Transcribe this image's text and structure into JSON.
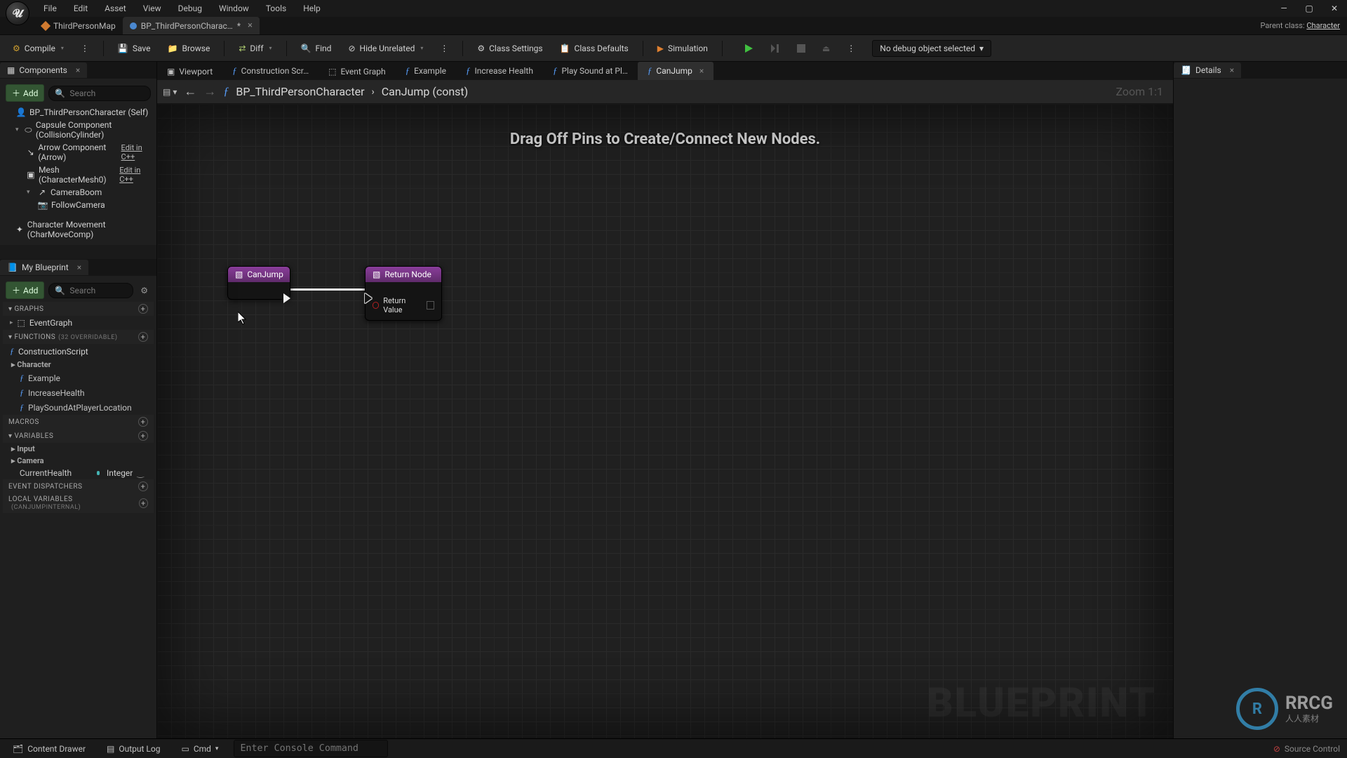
{
  "menu": [
    "File",
    "Edit",
    "Asset",
    "View",
    "Debug",
    "Window",
    "Tools",
    "Help"
  ],
  "asset_tabs": [
    {
      "label": "ThirdPersonMap",
      "active": false,
      "closable": false,
      "icon": "map-icon",
      "color": "#d07a30"
    },
    {
      "label": "BP_ThirdPersonCharac…",
      "active": true,
      "closable": true,
      "icon": "blueprint-icon",
      "color": "#4a88d0",
      "dirty": "*"
    }
  ],
  "parent_class": {
    "label": "Parent class:",
    "value": "Character"
  },
  "toolbar": {
    "compile": "Compile",
    "save": "Save",
    "browse": "Browse",
    "diff": "Diff",
    "find": "Find",
    "hide_unrelated": "Hide Unrelated",
    "class_settings": "Class Settings",
    "class_defaults": "Class Defaults",
    "simulation": "Simulation",
    "debug_summoner": "No debug object selected"
  },
  "components": {
    "title": "Components",
    "add": "Add",
    "search_ph": "Search",
    "tree": [
      {
        "label": "BP_ThirdPersonCharacter (Self)",
        "indent": 0,
        "icon": "actor-icon"
      },
      {
        "label": "Capsule Component (CollisionCylinder)",
        "indent": 1,
        "icon": "capsule-icon"
      },
      {
        "label": "Arrow Component (Arrow)",
        "indent": 2,
        "icon": "arrow-comp-icon",
        "edit": "Edit in C++"
      },
      {
        "label": "Mesh (CharacterMesh0)",
        "indent": 2,
        "icon": "mesh-icon",
        "edit": "Edit in C++"
      },
      {
        "label": "CameraBoom",
        "indent": 2,
        "icon": "spring-arm-icon",
        "expandable": true
      },
      {
        "label": "FollowCamera",
        "indent": 3,
        "icon": "camera-icon"
      },
      {
        "label": "Character Movement (CharMoveComp)",
        "indent": 1,
        "icon": "movement-icon"
      }
    ]
  },
  "my_blueprint": {
    "title": "My Blueprint",
    "add": "Add",
    "search_ph": "Search",
    "sections": {
      "graphs": {
        "title": "GRAPHS",
        "items": [
          {
            "label": "EventGraph",
            "icon": "graph-icon"
          }
        ]
      },
      "functions": {
        "title": "FUNCTIONS",
        "override": "(32 OVERRIDABLE)",
        "items": [
          {
            "label": "ConstructionScript",
            "icon": "fn-icon"
          }
        ],
        "category": "Character",
        "cat_items": [
          {
            "label": "Example",
            "icon": "fn-icon"
          },
          {
            "label": "IncreaseHealth",
            "icon": "fn-icon"
          },
          {
            "label": "PlaySoundAtPlayerLocation",
            "icon": "fn-icon"
          }
        ]
      },
      "macros": {
        "title": "MACROS"
      },
      "vars": {
        "title": "VARIABLES",
        "cats": [
          {
            "name": "Input"
          },
          {
            "name": "Camera"
          }
        ],
        "items": [
          {
            "name": "CurrentHealth",
            "type": "Integer"
          }
        ]
      },
      "event_disp": {
        "title": "EVENT DISPATCHERS"
      },
      "local_vars": {
        "title": "LOCAL VARIABLES",
        "context": "(CANJUMPINTERNAL)"
      }
    }
  },
  "tabs": [
    {
      "label": "Viewport",
      "icon": "viewport-icon"
    },
    {
      "label": "Construction Scr…",
      "icon": "fn-icon"
    },
    {
      "label": "Event Graph",
      "icon": "graph-icon"
    },
    {
      "label": "Example",
      "icon": "fn-icon"
    },
    {
      "label": "Increase Health",
      "icon": "fn-icon"
    },
    {
      "label": "Play Sound at Pl…",
      "icon": "fn-icon"
    },
    {
      "label": "CanJump",
      "icon": "fn-icon",
      "active": true,
      "closable": true
    }
  ],
  "details": {
    "title": "Details"
  },
  "breadcrumb": {
    "root": "BP_ThirdPersonCharacter",
    "leaf": "CanJump (const)",
    "zoom": "Zoom 1:1"
  },
  "graph": {
    "hint": "Drag Off Pins to Create/Connect New Nodes.",
    "watermark": "BLUEPRINT",
    "nodes": {
      "entry": {
        "title": "CanJump"
      },
      "return": {
        "title": "Return Node",
        "pin": "Return Value"
      }
    }
  },
  "bottom": {
    "content_drawer": "Content Drawer",
    "output_log": "Output Log",
    "cmd": "Cmd",
    "cmd_ph": "Enter Console Command",
    "source_control": "Source Control"
  }
}
